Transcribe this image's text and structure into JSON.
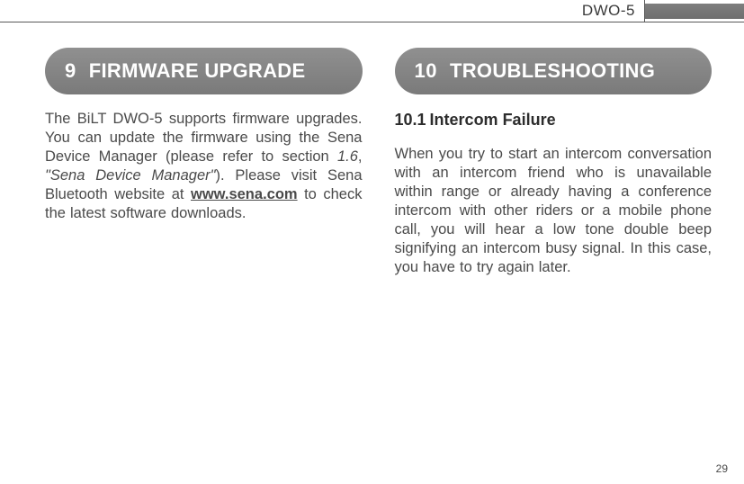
{
  "header": {
    "device": "DWO-5"
  },
  "left": {
    "chapter_num": "9",
    "chapter_title": "FIRMWARE UPGRADE",
    "p1_a": "The BiLT DWO-5 supports firmware upgrades. You can update the firmware using the Sena Device Manager (please refer to section ",
    "p1_ref": "1.6",
    "p1_b": ", ",
    "p1_quote": "\"Sena Device Manager\"",
    "p1_c": "). Please visit Sena Bluetooth website at ",
    "p1_link": "www.sena.com",
    "p1_d": " to check the latest software downloads."
  },
  "right": {
    "chapter_num": "10",
    "chapter_title": "TROUBLESHOOTING",
    "sub_num": "10.1",
    "sub_title": "Intercom Failure",
    "p1": "When you try to start an intercom conversation with an intercom friend who is unavailable within range or already having a conference intercom with other riders or a mobile phone call, you will hear a low tone double beep signifying an intercom busy signal. In this case, you have to try again later."
  },
  "page_number": "29"
}
